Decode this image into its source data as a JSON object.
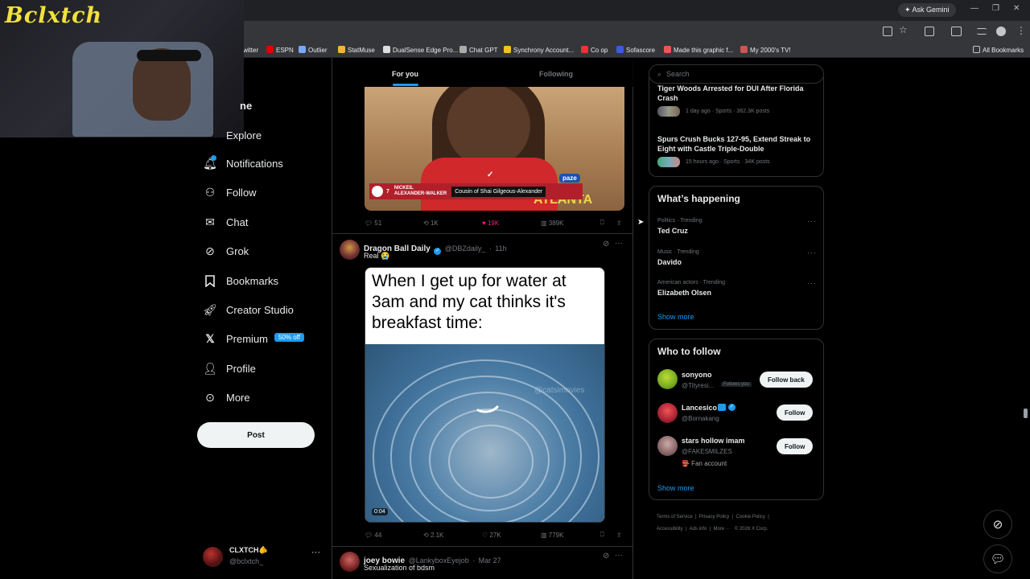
{
  "browser": {
    "gemini_label": "Ask Gemini",
    "all_bookmarks": "All Bookmarks",
    "bookmarks": [
      {
        "label": "witter",
        "color": "#1d1d1d"
      },
      {
        "label": "ESPN",
        "color": "#d00"
      },
      {
        "label": "Outlier",
        "color": "#7aa7ff"
      },
      {
        "label": "StatMuse",
        "color": "#f2b632"
      },
      {
        "label": "DualSense Edge Pro...",
        "color": "#ddd"
      },
      {
        "label": "Chat GPT",
        "color": "#aaa"
      },
      {
        "label": "Synchrony Account...",
        "color": "#f4c21b"
      },
      {
        "label": "Co op",
        "color": "#e33"
      },
      {
        "label": "Sofascore",
        "color": "#3b5bdb"
      },
      {
        "label": "Made this graphic f...",
        "color": "#e55"
      },
      {
        "label": "My 2000's TV!",
        "color": "#c55"
      }
    ]
  },
  "webcam": {
    "logo_text": "Bclxtch"
  },
  "nav": {
    "home": "ne",
    "explore": "Explore",
    "notifications": "Notifications",
    "follow": "Follow",
    "chat": "Chat",
    "grok": "Grok",
    "bookmarks": "Bookmarks",
    "creator_studio": "Creator Studio",
    "premium": "Premium",
    "premium_badge": "50% off",
    "profile": "Profile",
    "more": "More",
    "post_button": "Post"
  },
  "account": {
    "name": "CLXTCH🫵",
    "handle": "@bclxtch_"
  },
  "feed": {
    "tabs": [
      "For you",
      "Following"
    ],
    "post1": {
      "caption_num": "7",
      "caption_name_1": "NICKEIL",
      "caption_name_2": "ALEXANDER-WALKER",
      "caption_desc": "Cousin of Shai Gilgeous-Alexander",
      "jersey_text": "ATLANTA",
      "sponsor": "paze",
      "replies": "51",
      "reposts": "1K",
      "likes": "19K",
      "views": "389K"
    },
    "post2": {
      "name": "Dragon Ball Daily",
      "handle": "@DBZdaily_",
      "time": "11h",
      "text": "Real 😭",
      "meme_text": "When I get up for water at 3am and my cat thinks it's breakfast time:",
      "watermark": "@catsimovies",
      "duration": "0:04",
      "replies": "44",
      "reposts": "2.1K",
      "likes": "27K",
      "views": "779K"
    },
    "post3": {
      "name": "joey bowie",
      "handle": "@LankyboxEyejob",
      "time": "Mar 27",
      "text": "Sexualization of bdsm"
    }
  },
  "sidebar": {
    "search_placeholder": "Search",
    "news": [
      {
        "title": "Tiger Woods Arrested for DUI After Florida Crash",
        "meta": "1 day ago · Sports · 362.3K posts"
      },
      {
        "title": "Spurs Crush Bucks 127-95, Extend Streak to Eight with Castle Triple-Double",
        "meta": "15 hours ago · Sports · 34K posts"
      }
    ],
    "happening_title": "What’s happening",
    "trends": [
      {
        "context": "Politics · Trending",
        "name": "Ted Cruz"
      },
      {
        "context": "Music · Trending",
        "name": "Davido"
      },
      {
        "context": "American actors · Trending",
        "name": "Elizabeth Olsen"
      }
    ],
    "show_more": "Show more",
    "who_title": "Who to follow",
    "who": [
      {
        "name": "sonyono",
        "handle": "@Tityresi...",
        "extra": "Follows you",
        "button": "Follow back"
      },
      {
        "name": "Lancesico",
        "handle": "@Bornakang",
        "extra": "",
        "button": "Follow"
      },
      {
        "name": "stars hollow imam",
        "handle": "@FAKESMILZES",
        "extra": "👺 Fan account",
        "button": "Follow"
      }
    ],
    "show_more_2": "Show more",
    "footer": [
      "Terms of Service",
      "Privacy Policy",
      "Cookie Policy",
      "Accessibility",
      "Ads info",
      "More ···",
      "© 2026 X Corp."
    ]
  },
  "colors": {
    "accent": "#1d9bf0",
    "like": "#f91880",
    "bg": "#000000",
    "border": "#2f3336"
  }
}
